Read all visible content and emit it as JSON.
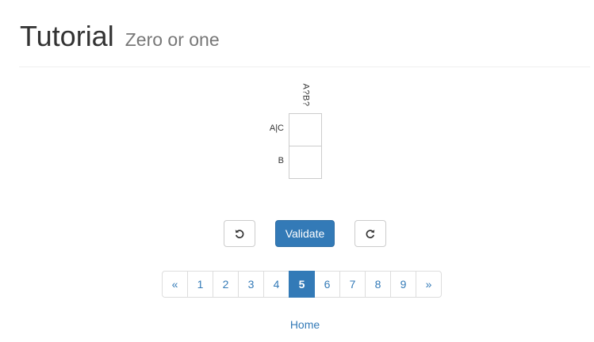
{
  "header": {
    "title": "Tutorial",
    "subtitle": "Zero or one"
  },
  "puzzle": {
    "column_headers": [
      "A?B?"
    ],
    "row_labels": [
      "A|C",
      "B"
    ],
    "cells": [
      [
        "",
        ""
      ]
    ]
  },
  "actions": {
    "undo_icon": "undo-icon",
    "validate_label": "Validate",
    "redo_icon": "redo-icon"
  },
  "pagination": {
    "prev_label": "«",
    "pages": [
      "1",
      "2",
      "3",
      "4",
      "5",
      "6",
      "7",
      "8",
      "9"
    ],
    "active_page": "5",
    "next_label": "»"
  },
  "footer": {
    "home_label": "Home"
  },
  "colors": {
    "primary": "#337ab7",
    "border": "#cccccc",
    "muted_text": "#777777"
  }
}
